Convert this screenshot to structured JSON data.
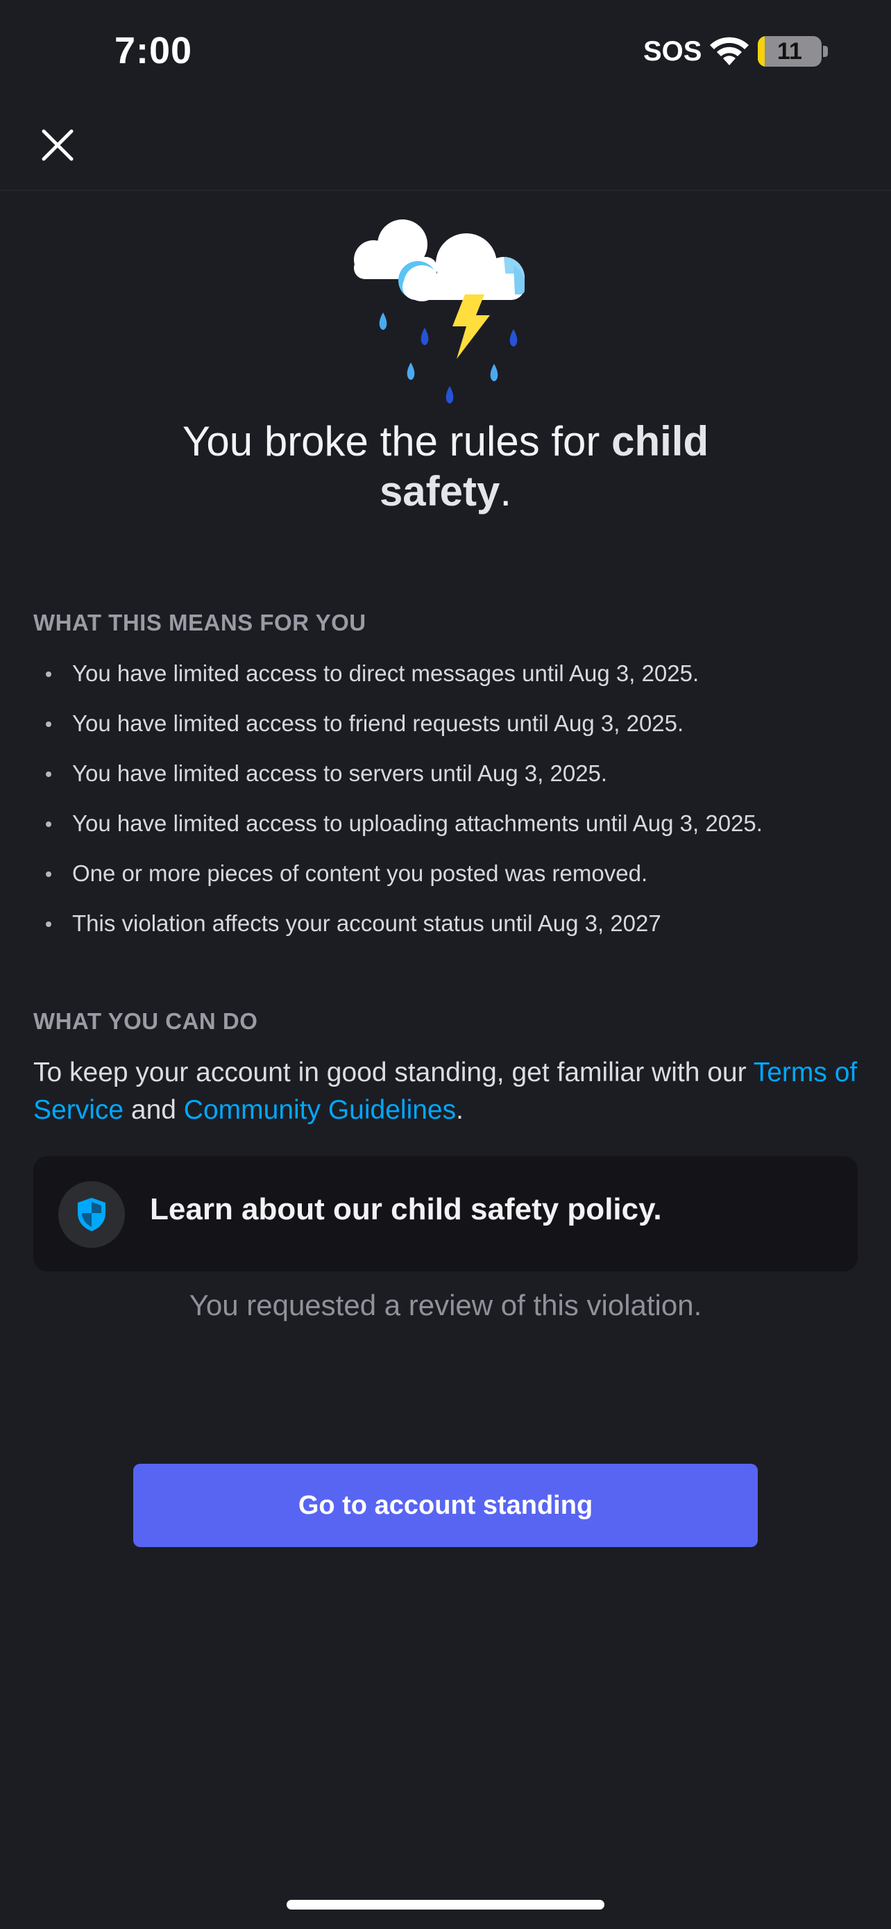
{
  "status_bar": {
    "time": "7:00",
    "sos": "SOS",
    "battery_level": "11",
    "battery_fraction": 0.11
  },
  "header": {
    "close_icon": "close-icon"
  },
  "illustration": {
    "icon": "storm-cloud-icon"
  },
  "title": {
    "prefix": "You broke the rules for ",
    "emphasis": "child safety",
    "suffix": "."
  },
  "section_means": {
    "heading": "WHAT THIS MEANS FOR YOU",
    "items": [
      "You have limited access to direct messages until Aug 3, 2025.",
      "You have limited access to friend requests until Aug 3, 2025.",
      "You have limited access to servers until Aug 3, 2025.",
      "You have limited access to uploading attachments until Aug 3, 2025.",
      "One or more pieces of content you posted was removed.",
      "This violation affects your account status until Aug 3, 2027"
    ]
  },
  "section_can_do": {
    "heading": "WHAT YOU CAN DO",
    "text_before": "To keep your account in good standing, get familiar with our ",
    "tos_link": "Terms of Service",
    "text_middle": " and ",
    "guidelines_link": "Community Guidelines",
    "text_after": "."
  },
  "policy_card": {
    "icon": "shield-icon",
    "label": "Learn about our child safety policy."
  },
  "review_status": "You requested a review of this violation.",
  "cta": {
    "label": "Go to account standing"
  },
  "colors": {
    "background": "#1c1d23",
    "link": "#00a8fc",
    "button": "#5865f2",
    "card": "#141418"
  }
}
